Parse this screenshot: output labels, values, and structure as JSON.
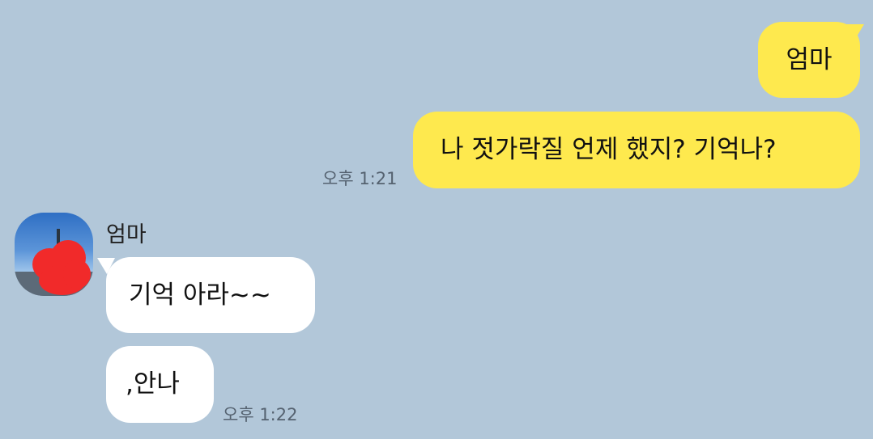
{
  "chat": {
    "messages_out": [
      {
        "text": "엄마"
      },
      {
        "text": "나 젓가락질 언제 했지? 기억나?",
        "time": "오후 1:21"
      }
    ],
    "contact": {
      "name": "엄마"
    },
    "messages_in": [
      {
        "text": "기억 아라~~"
      },
      {
        "text": ",안나",
        "time": "오후 1:22"
      }
    ]
  },
  "colors": {
    "background": "#b2c7d9",
    "outgoing_bubble": "#fee94e",
    "incoming_bubble": "#ffffff",
    "timestamp": "#556270"
  },
  "icons": {
    "avatar": "profile-photo-redacted"
  }
}
